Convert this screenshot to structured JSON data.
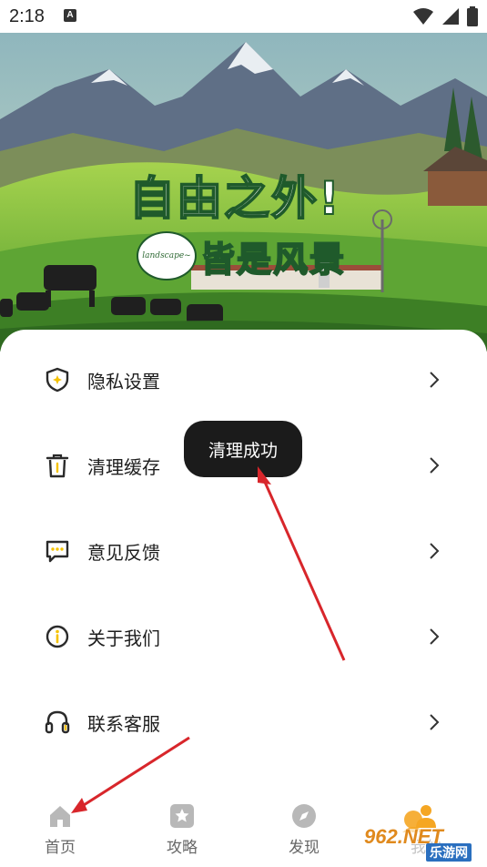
{
  "status_bar": {
    "time": "2:18",
    "notification_icon": "A",
    "icons": [
      "wifi-icon",
      "signal-icon",
      "battery-icon"
    ]
  },
  "banner": {
    "headline_line1": "自由之外!",
    "headline_line2": "皆是风景",
    "badge": "landscape~",
    "colors": {
      "sky": "#a7c7c9",
      "grass": "#7fbf3d",
      "text": "#ffffff",
      "outline": "#1f5a2b"
    }
  },
  "menu": {
    "items": [
      {
        "label": "隐私设置",
        "icon": "shield-icon"
      },
      {
        "label": "清理缓存",
        "icon": "trash-icon"
      },
      {
        "label": "意见反馈",
        "icon": "message-icon"
      },
      {
        "label": "关于我们",
        "icon": "info-icon"
      },
      {
        "label": "联系客服",
        "icon": "headset-icon"
      }
    ]
  },
  "toast": {
    "text": "清理成功"
  },
  "tabbar": {
    "tabs": [
      {
        "label": "首页",
        "icon": "home-icon"
      },
      {
        "label": "攻略",
        "icon": "star-icon"
      },
      {
        "label": "发现",
        "icon": "compass-icon"
      },
      {
        "label": "我的",
        "icon": "profile-icon"
      }
    ]
  },
  "watermark": {
    "brand": "962.NET",
    "subtitle": "乐游网"
  },
  "accent_colors": {
    "arrow": "#d8262b",
    "toast_bg": "#1b1b1b",
    "icon": "#333333",
    "tab_icon": "#b8b8b8"
  }
}
